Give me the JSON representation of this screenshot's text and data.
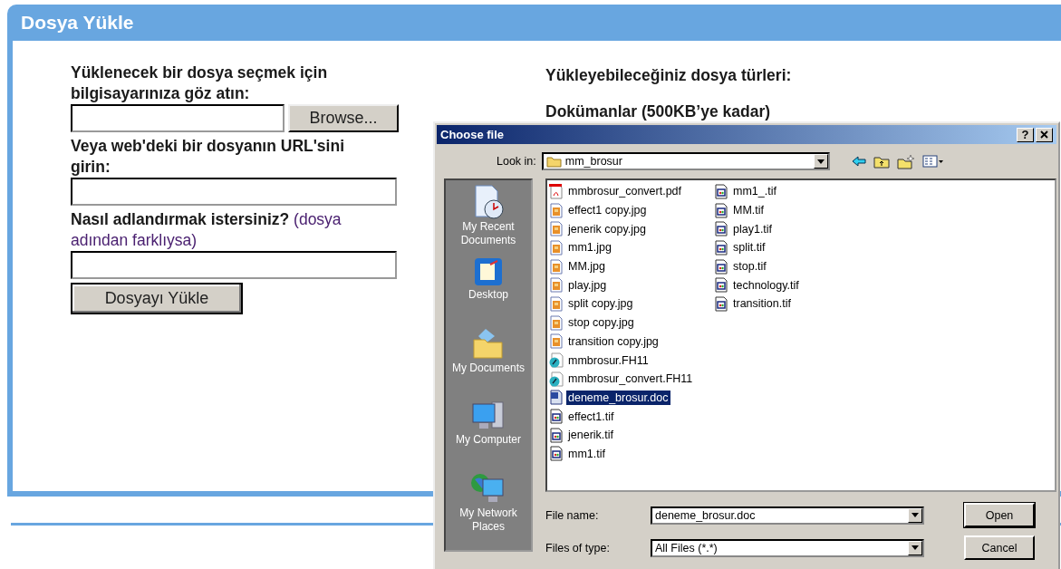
{
  "page": {
    "title": "Dosya Yükle",
    "browse_label": "Yüklenecek bir dosya seçmek için bilgisayarınıza göz atın:",
    "browse_button": "Browse...",
    "url_label": "Veya web'deki bir dosyanın URL'sini girin:",
    "name_label": "**Nasıl adlandırmak istersiniz?** (dosya adından farklıysa)",
    "submit_button": "Dosyayı Yükle",
    "types_heading": "Yükleyebileceğiniz dosya türleri:",
    "types_item": "Dokümanlar (500KB’ye kadar)"
  },
  "dialog": {
    "title": "Choose file",
    "help_button": "?",
    "look_in_label": "Look in:",
    "look_in_value": "mm_brosur",
    "places": [
      {
        "kind": "recent",
        "label": "My Recent Documents"
      },
      {
        "kind": "desktop",
        "label": "Desktop"
      },
      {
        "kind": "documents",
        "label": "My Documents"
      },
      {
        "kind": "computer",
        "label": "My Computer"
      },
      {
        "kind": "network",
        "label": "My Network Places"
      }
    ],
    "files": [
      {
        "kind": "pdf",
        "name": "mmbrosur_convert.pdf",
        "selected": false
      },
      {
        "kind": "jpg",
        "name": "effect1 copy.jpg",
        "selected": false
      },
      {
        "kind": "jpg",
        "name": "jenerik copy.jpg",
        "selected": false
      },
      {
        "kind": "jpg",
        "name": "mm1.jpg",
        "selected": false
      },
      {
        "kind": "jpg",
        "name": "MM.jpg",
        "selected": false
      },
      {
        "kind": "jpg",
        "name": "play.jpg",
        "selected": false
      },
      {
        "kind": "jpg",
        "name": "split copy.jpg",
        "selected": false
      },
      {
        "kind": "jpg",
        "name": "stop copy.jpg",
        "selected": false
      },
      {
        "kind": "jpg",
        "name": "transition copy.jpg",
        "selected": false
      },
      {
        "kind": "fh",
        "name": "mmbrosur.FH11",
        "selected": false
      },
      {
        "kind": "fh",
        "name": "mmbrosur_convert.FH11",
        "selected": false
      },
      {
        "kind": "doc",
        "name": "deneme_brosur.doc",
        "selected": true
      },
      {
        "kind": "tif",
        "name": "effect1.tif",
        "selected": false
      },
      {
        "kind": "tif",
        "name": "jenerik.tif",
        "selected": false
      },
      {
        "kind": "tif",
        "name": "mm1.tif",
        "selected": false
      },
      {
        "kind": "tif",
        "name": "mm1_.tif",
        "selected": false
      },
      {
        "kind": "tif",
        "name": "MM.tif",
        "selected": false
      },
      {
        "kind": "tif",
        "name": "play1.tif",
        "selected": false
      },
      {
        "kind": "tif",
        "name": "split.tif",
        "selected": false
      },
      {
        "kind": "tif",
        "name": "stop.tif",
        "selected": false
      },
      {
        "kind": "tif",
        "name": "technology.tif",
        "selected": false
      },
      {
        "kind": "tif",
        "name": "transition.tif",
        "selected": false
      }
    ],
    "file_name_label": "File name:",
    "file_name_value": "deneme_brosur.doc",
    "file_type_label": "Files of type:",
    "file_type_value": "All Files (*.*)",
    "open_button": "Open",
    "cancel_button": "Cancel"
  }
}
